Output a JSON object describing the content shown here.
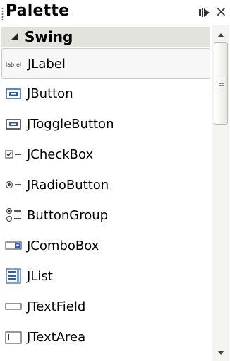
{
  "panel": {
    "title": "Palette",
    "pin_icon": "pin-icon",
    "close_symbol": "×"
  },
  "category": {
    "label": "Swing",
    "icon": "collapse-triangle-icon"
  },
  "items": [
    {
      "label": "JLabel",
      "icon": "jlabel-icon",
      "selected": true
    },
    {
      "label": "JButton",
      "icon": "jbutton-icon",
      "selected": false
    },
    {
      "label": "JToggleButton",
      "icon": "jtogglebutton-icon",
      "selected": false
    },
    {
      "label": "JCheckBox",
      "icon": "jcheckbox-icon",
      "selected": false
    },
    {
      "label": "JRadioButton",
      "icon": "jradiobutton-icon",
      "selected": false
    },
    {
      "label": "ButtonGroup",
      "icon": "buttongroup-icon",
      "selected": false
    },
    {
      "label": "JComboBox",
      "icon": "jcombobox-icon",
      "selected": false
    },
    {
      "label": "JList",
      "icon": "jlist-icon",
      "selected": false
    },
    {
      "label": "JTextField",
      "icon": "jtextfield-icon",
      "selected": false
    },
    {
      "label": "JTextArea",
      "icon": "jtextarea-icon",
      "selected": false
    }
  ],
  "colors": {
    "category_bg": "#e3e3de",
    "selection_border": "#c9c9c9",
    "icon_blue": "#2b5fa8"
  }
}
